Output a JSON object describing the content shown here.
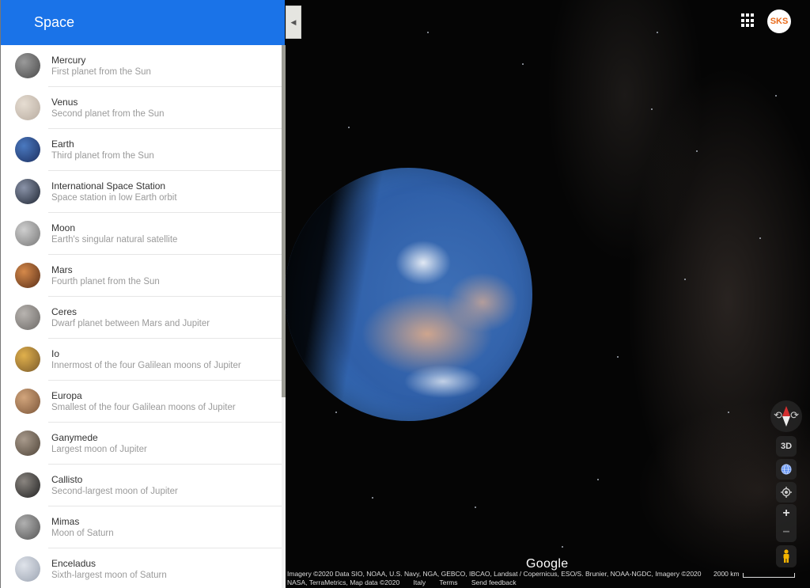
{
  "sidebar": {
    "title": "Space",
    "items": [
      {
        "name": "Mercury",
        "description": "First planet from the Sun",
        "thumb_colors": [
          "#9a9a9a",
          "#4a4a4a"
        ]
      },
      {
        "name": "Venus",
        "description": "Second planet from the Sun",
        "thumb_colors": [
          "#e6ddd2",
          "#b8aca0"
        ]
      },
      {
        "name": "Earth",
        "description": "Third planet from the Sun",
        "thumb_colors": [
          "#4a79c0",
          "#1c2f60"
        ]
      },
      {
        "name": "International Space Station",
        "description": "Space station in low Earth orbit",
        "thumb_colors": [
          "#8a93a8",
          "#1f2633"
        ]
      },
      {
        "name": "Moon",
        "description": "Earth's singular natural satellite",
        "thumb_colors": [
          "#cfcfcf",
          "#777777"
        ]
      },
      {
        "name": "Mars",
        "description": "Fourth planet from the Sun",
        "thumb_colors": [
          "#d5894a",
          "#5a2f18"
        ]
      },
      {
        "name": "Ceres",
        "description": "Dwarf planet between Mars and Jupiter",
        "thumb_colors": [
          "#b8b4b0",
          "#6d6a67"
        ]
      },
      {
        "name": "Io",
        "description": "Innermost of the four Galilean moons of Jupiter",
        "thumb_colors": [
          "#e0b04c",
          "#7a5a2a"
        ]
      },
      {
        "name": "Europa",
        "description": "Smallest of the four Galilean moons of Jupiter",
        "thumb_colors": [
          "#d2a57c",
          "#7b5538"
        ]
      },
      {
        "name": "Ganymede",
        "description": "Largest moon of Jupiter",
        "thumb_colors": [
          "#a89a8c",
          "#4f4438"
        ]
      },
      {
        "name": "Callisto",
        "description": "Second-largest moon of Jupiter",
        "thumb_colors": [
          "#8a8580",
          "#222222"
        ]
      },
      {
        "name": "Mimas",
        "description": "Moon of Saturn",
        "thumb_colors": [
          "#b0b0b0",
          "#555555"
        ]
      },
      {
        "name": "Enceladus",
        "description": "Sixth-largest moon of Saturn",
        "thumb_colors": [
          "#dfe3ea",
          "#9ca4b2"
        ]
      }
    ]
  },
  "header": {
    "collapse_icon": "triangle-left",
    "apps_icon": "grid-9-dots",
    "avatar_initials": "SKS"
  },
  "controls": {
    "compass_icon": "compass",
    "three_d_label": "3D",
    "globe_icon": "globe",
    "location_icon": "crosshair",
    "zoom_in_label": "+",
    "zoom_out_label": "−",
    "pegman_icon": "pegman"
  },
  "footer": {
    "logo": "Google",
    "attribution_line1": "Imagery ©2020 Data SIO, NOAA, U.S. Navy, NGA, GEBCO, IBCAO, Landsat / Copernicus, ESO/S. Brunier, NOAA-NGDC, Imagery ©2020",
    "attribution_line2": "NASA, TerraMetrics, Map data ©2020",
    "region": "Italy",
    "terms": "Terms",
    "feedback": "Send feedback",
    "scale_label": "2000 km"
  },
  "colors": {
    "header_blue": "#1a73e8",
    "avatar_orange": "#e96b1b",
    "compass_red": "#d32f2f",
    "pegman_yellow": "#f4b400"
  }
}
